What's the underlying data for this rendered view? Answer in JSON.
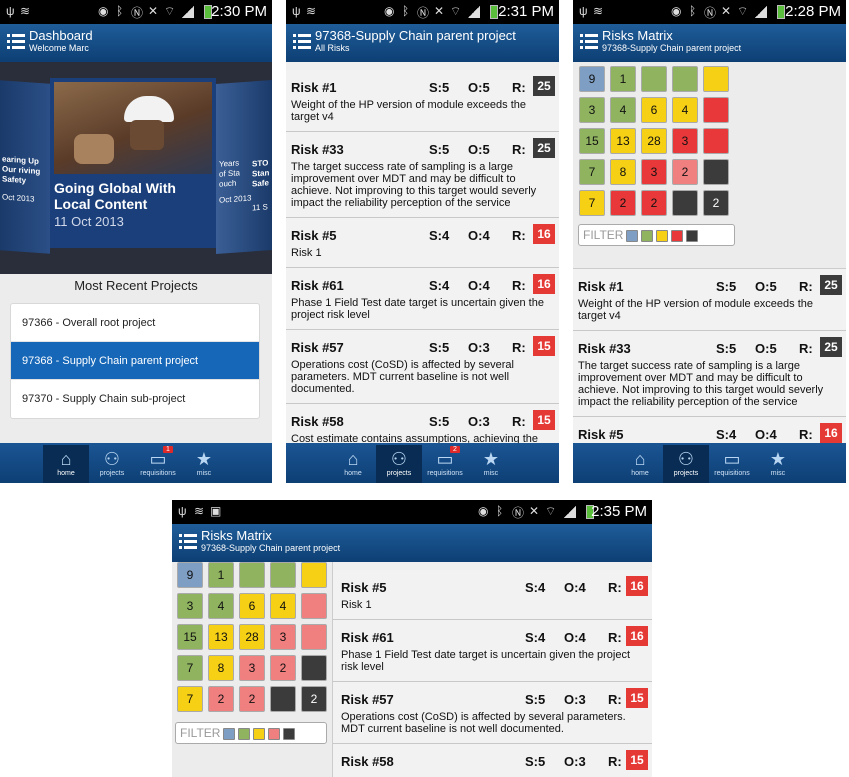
{
  "status_bars": [
    {
      "time": "2:30 PM"
    },
    {
      "time": "2:31 PM"
    },
    {
      "time": "2:28 PM"
    },
    {
      "time": "2:35 PM"
    }
  ],
  "dashboard": {
    "title": "Dashboard",
    "subtitle": "Welcome Marc",
    "left_card_caption": "earing Up Our riving Safety",
    "left_card_date": "Oct 2013",
    "right_card_caption": "Years of Sta ouch",
    "right_card_date": "Oct 2013",
    "right_card_caption2": "STO Stan Safe",
    "right_card_date2": "11 S",
    "featured_headline": "Going Global With Local Content",
    "featured_date": "11 Oct 2013",
    "recent_heading": "Most Recent Projects",
    "projects": [
      {
        "label": "97366 - Overall root project"
      },
      {
        "label": "97368 - Supply Chain parent project"
      },
      {
        "label": "97370 - Supply Chain sub-project"
      }
    ]
  },
  "project_screen": {
    "title": "97368-Supply Chain parent project",
    "subtitle": "All Risks"
  },
  "matrix_screen": {
    "title": "Risks Matrix",
    "subtitle": "97368-Supply Chain parent project",
    "filter_label": "FILTER"
  },
  "footer": {
    "tabs": {
      "home": "home",
      "projects": "projects",
      "requisitions": "requisitions",
      "misc": "misc"
    },
    "requisitions_badge_p1": "1",
    "requisitions_badge_p2": "2"
  },
  "matrix": [
    {
      "value": "9",
      "color": "blue"
    },
    {
      "value": "1",
      "color": "green"
    },
    {
      "value": "",
      "color": "green"
    },
    {
      "value": "",
      "color": "green"
    },
    {
      "value": "",
      "color": "yellow"
    },
    {
      "value": "3",
      "color": "green"
    },
    {
      "value": "4",
      "color": "green"
    },
    {
      "value": "6",
      "color": "yellow"
    },
    {
      "value": "4",
      "color": "yellow"
    },
    {
      "value": "",
      "color": "red"
    },
    {
      "value": "15",
      "color": "green"
    },
    {
      "value": "13",
      "color": "yellow"
    },
    {
      "value": "28",
      "color": "yellow"
    },
    {
      "value": "3",
      "color": "red"
    },
    {
      "value": "",
      "color": "red"
    },
    {
      "value": "7",
      "color": "green"
    },
    {
      "value": "8",
      "color": "yellow"
    },
    {
      "value": "3",
      "color": "red"
    },
    {
      "value": "2",
      "color": "pink"
    },
    {
      "value": "",
      "color": "dark"
    },
    {
      "value": "7",
      "color": "yellow"
    },
    {
      "value": "2",
      "color": "red"
    },
    {
      "value": "2",
      "color": "red"
    },
    {
      "value": "",
      "color": "dark"
    },
    {
      "value": "2",
      "color": "dark"
    }
  ],
  "matrix_p4": [
    {
      "value": "9",
      "color": "blue"
    },
    {
      "value": "1",
      "color": "green"
    },
    {
      "value": "",
      "color": "green"
    },
    {
      "value": "",
      "color": "green"
    },
    {
      "value": "",
      "color": "yellow"
    },
    {
      "value": "3",
      "color": "green"
    },
    {
      "value": "4",
      "color": "green"
    },
    {
      "value": "6",
      "color": "yellow"
    },
    {
      "value": "4",
      "color": "yellow"
    },
    {
      "value": "",
      "color": "pink"
    },
    {
      "value": "15",
      "color": "green"
    },
    {
      "value": "13",
      "color": "yellow"
    },
    {
      "value": "28",
      "color": "yellow"
    },
    {
      "value": "3",
      "color": "pink"
    },
    {
      "value": "",
      "color": "pink"
    },
    {
      "value": "7",
      "color": "green"
    },
    {
      "value": "8",
      "color": "yellow"
    },
    {
      "value": "3",
      "color": "pink"
    },
    {
      "value": "2",
      "color": "pink"
    },
    {
      "value": "",
      "color": "dark"
    },
    {
      "value": "7",
      "color": "yellow"
    },
    {
      "value": "2",
      "color": "pink"
    },
    {
      "value": "2",
      "color": "pink"
    },
    {
      "value": "",
      "color": "dark"
    },
    {
      "value": "2",
      "color": "dark"
    }
  ],
  "filter_swatches": [
    "blue",
    "green",
    "yellow",
    "red",
    "dark"
  ],
  "risks": [
    {
      "id": "Risk #1",
      "s": "S:5",
      "o": "O:5",
      "r": "R:",
      "score": "25",
      "level": "dark",
      "desc": "Weight of the HP version of module exceeds the target v4"
    },
    {
      "id": "Risk #33",
      "s": "S:5",
      "o": "O:5",
      "r": "R:",
      "score": "25",
      "level": "dark",
      "desc": "The target success rate of sampling is a large improvement over MDT and may be difficult to achieve. Not improving to this target would severly impact the reliability perception of the service"
    },
    {
      "id": "Risk #5",
      "s": "S:4",
      "o": "O:4",
      "r": "R:",
      "score": "16",
      "level": "red",
      "desc": "Risk 1"
    },
    {
      "id": "Risk #61",
      "s": "S:4",
      "o": "O:4",
      "r": "R:",
      "score": "16",
      "level": "red",
      "desc": "Phase 1 Field Test date target is uncertain given the project risk level"
    },
    {
      "id": "Risk #57",
      "s": "S:5",
      "o": "O:3",
      "r": "R:",
      "score": "15",
      "level": "red",
      "desc": "Operations cost (CoSD) is affected by several parameters. MDT current baseline is not well documented."
    },
    {
      "id": "Risk #58",
      "s": "S:5",
      "o": "O:3",
      "r": "R:",
      "score": "15",
      "level": "red",
      "desc": "Cost estimate contains assumptions, achieving the target remains uncertain. Cost to buy"
    }
  ]
}
